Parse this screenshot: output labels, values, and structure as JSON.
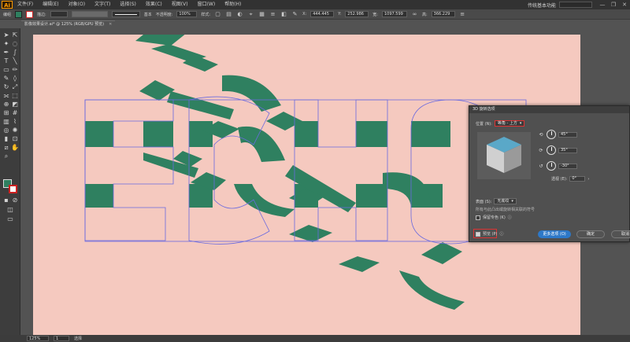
{
  "app": {
    "logo": "Ai",
    "menu": [
      "文件(F)",
      "编辑(E)",
      "对象(O)",
      "文字(T)",
      "选择(S)",
      "效果(C)",
      "视图(V)",
      "窗口(W)",
      "帮助(H)"
    ],
    "workspace": "传统基本功能",
    "window_controls": [
      "—",
      "❐",
      "✕"
    ]
  },
  "controlbar": {
    "label": "编组",
    "stroke_label": "描边:",
    "style_label": "基本",
    "opacity_label": "不透明度:",
    "opacity_value": "100%",
    "style_word": "样式:",
    "x_label": "X:",
    "x_value": "444.445",
    "y_label": "Y:",
    "y_value": "252.986",
    "w_label": "宽:",
    "w_value": "1097.599",
    "h_label": "高:",
    "h_value": "366.229"
  },
  "document": {
    "tab_title": "影像效果设计.ai* @ 125% (RGB/GPU 预览)",
    "close": "✕"
  },
  "status": {
    "zoom": "125%",
    "page": "1",
    "mode": "选择"
  },
  "dialog": {
    "title": "3D 旋转选项",
    "position_label": "位置 (N):",
    "position_value": "等角 - 上方",
    "rot_x": "45°",
    "rot_y": "35°",
    "rot_z": "-30°",
    "perspective_label": "透视 (E):",
    "perspective_value": "0°",
    "surface_label": "表面 (S):",
    "surface_value": "无底纹",
    "note": "所有与此凸出或旋转相关联的符号",
    "keep_spot_label": "保留专色 (K)",
    "preview_label": "预览 (P)",
    "map_art_button": "贴图 (M)...",
    "more_options_button": "更多选项 (O)",
    "ok_button": "确定",
    "cancel_button": "取消"
  },
  "colors": {
    "artboard": "#f5c9bf",
    "shape_green": "#2f8060",
    "selection_blue": "#6a6adf",
    "cube_top": "#5aa8c8",
    "cube_left": "#d0d0d0",
    "cube_right": "#9a9a9a"
  },
  "artwork": {
    "text": "ECHO"
  }
}
